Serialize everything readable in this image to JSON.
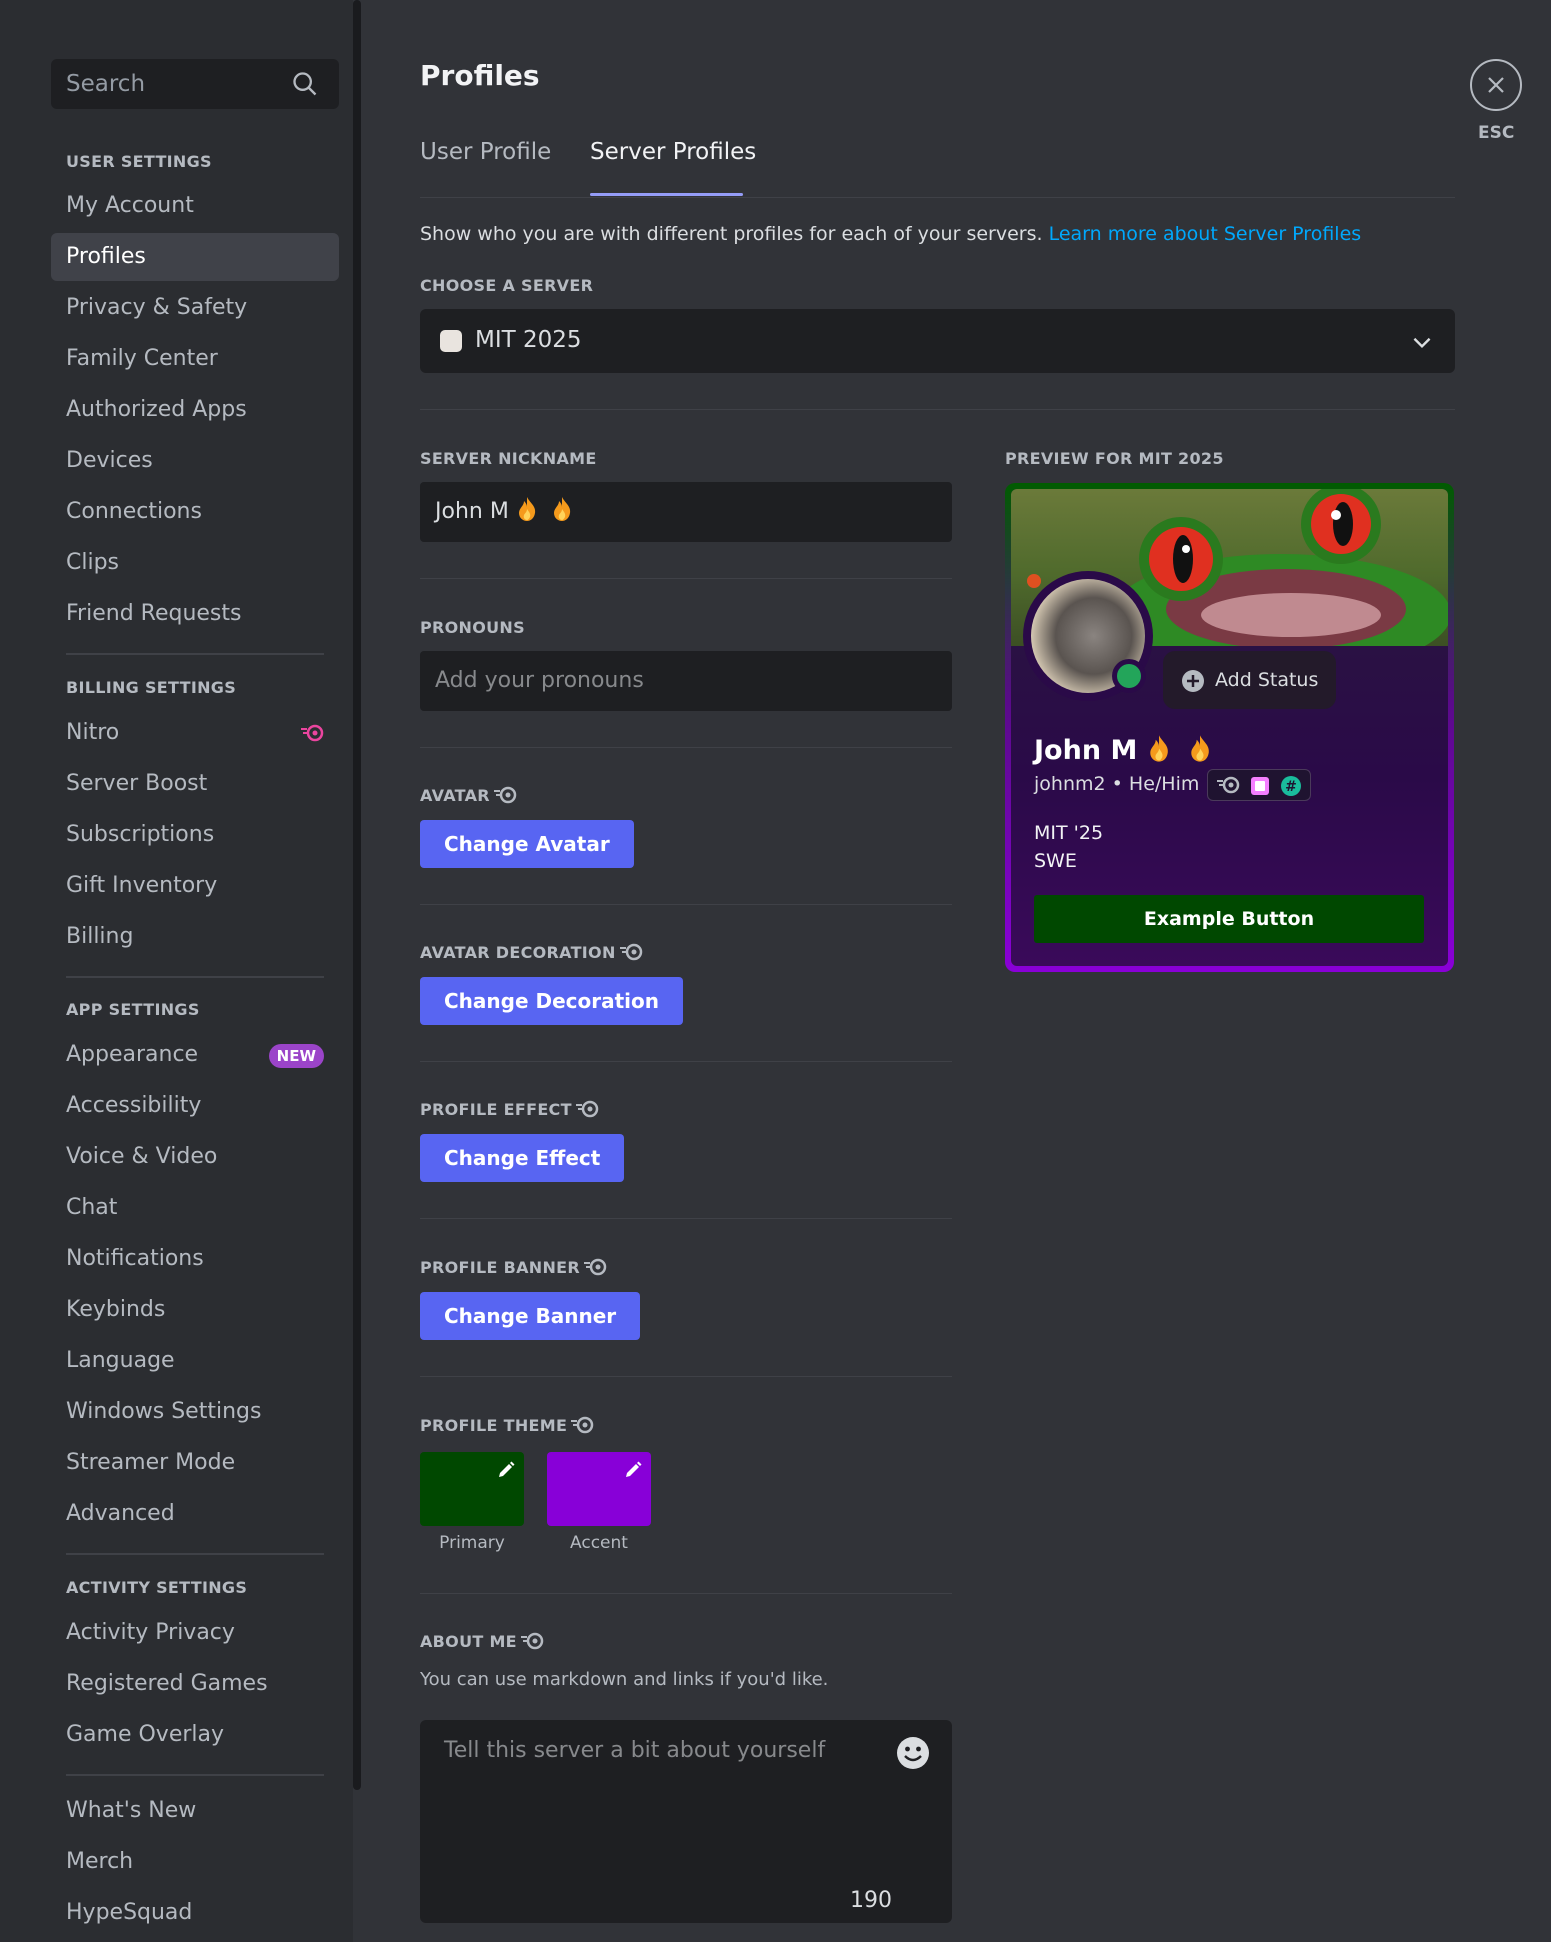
{
  "sidebar": {
    "search_placeholder": "Search",
    "sections": {
      "user": "USER SETTINGS",
      "billing": "BILLING SETTINGS",
      "app": "APP SETTINGS",
      "activity": "ACTIVITY SETTINGS"
    },
    "user_items": [
      "My Account",
      "Profiles",
      "Privacy & Safety",
      "Family Center",
      "Authorized Apps",
      "Devices",
      "Connections",
      "Clips",
      "Friend Requests"
    ],
    "billing_items": [
      "Nitro",
      "Server Boost",
      "Subscriptions",
      "Gift Inventory",
      "Billing"
    ],
    "app_items": [
      "Appearance",
      "Accessibility",
      "Voice & Video",
      "Chat",
      "Notifications",
      "Keybinds",
      "Language",
      "Windows Settings",
      "Streamer Mode",
      "Advanced"
    ],
    "activity_items": [
      "Activity Privacy",
      "Registered Games",
      "Game Overlay"
    ],
    "misc_items": [
      "What's New",
      "Merch",
      "HypeSquad"
    ],
    "new_badge": "NEW",
    "active_item": "Profiles"
  },
  "main": {
    "title": "Profiles",
    "tabs": [
      "User Profile",
      "Server Profiles"
    ],
    "active_tab": "Server Profiles",
    "intro_text": "Show who you are with different profiles for each of your servers. ",
    "intro_link": "Learn more about Server Profiles",
    "choose_server_label": "CHOOSE A SERVER",
    "selected_server": "MIT 2025",
    "nickname_label": "SERVER NICKNAME",
    "nickname_value": "John M",
    "pronouns_label": "PRONOUNS",
    "pronouns_placeholder": "Add your pronouns",
    "avatar_label": "AVATAR",
    "change_avatar": "Change Avatar",
    "decoration_label": "AVATAR DECORATION",
    "change_decoration": "Change Decoration",
    "effect_label": "PROFILE EFFECT",
    "change_effect": "Change Effect",
    "banner_label": "PROFILE BANNER",
    "change_banner": "Change Banner",
    "theme_label": "PROFILE THEME",
    "theme_primary_label": "Primary",
    "theme_accent_label": "Accent",
    "theme_primary_color": "#004800",
    "theme_accent_color": "#8800d8",
    "about_label": "ABOUT ME",
    "about_hint": "You can use markdown and links if you'd like.",
    "about_placeholder": "Tell this server a bit about yourself",
    "about_counter": "190"
  },
  "preview": {
    "label": "PREVIEW FOR MIT 2025",
    "add_status": "Add Status",
    "name": "John M",
    "handle": "johnm2",
    "pronouns": "He/Him",
    "separator": "•",
    "bio_line1": "MIT '25",
    "bio_line2": "SWE",
    "example_button": "Example Button"
  },
  "close": {
    "esc_label": "ESC"
  },
  "colors": {
    "accent": "#5865f2",
    "link": "#00a8fc",
    "status_online": "#23a55a",
    "nitro_pink": "#eb459f"
  },
  "icons": [
    "search-icon",
    "chevron-down-icon",
    "close-icon",
    "nitro-icon",
    "pencil-icon",
    "emoji-icon",
    "plus-circle-icon",
    "fire-icon"
  ]
}
